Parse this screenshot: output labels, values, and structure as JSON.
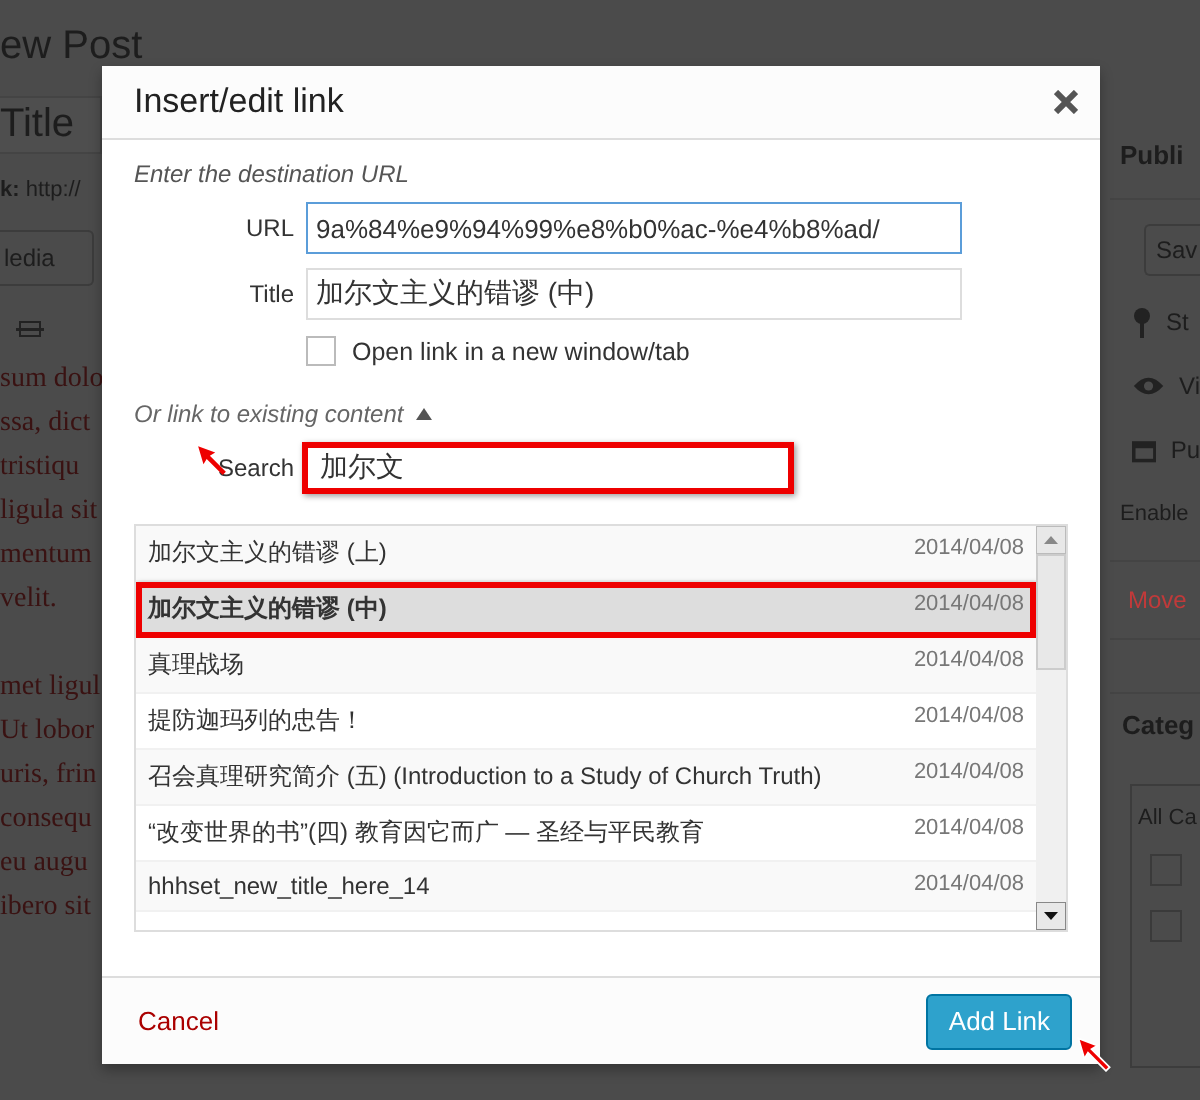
{
  "background": {
    "heading": "ew Post",
    "title_field": "Title",
    "permalink_label": "k:",
    "permalink": "http://",
    "media_button": "ledia",
    "body_paragraphs": [
      [
        "sum dolo",
        "ssa, dict",
        "tristiqu",
        "ligula sit",
        "mentum",
        "velit."
      ],
      [
        "met ligul",
        "Ut lobor",
        "uris, frin",
        "consequ",
        "eu augu",
        "ibero sit"
      ]
    ],
    "sidebar": {
      "publish_heading": "Publi",
      "save_button": "Sav",
      "status": "St",
      "visibility": "Vi",
      "publish": "Pu",
      "enable": "Enable",
      "move": "Move",
      "categories_heading": "Categ",
      "categories_tab": "All Ca",
      "category_checkboxes": [
        {
          "checked": false
        },
        {
          "checked": false
        }
      ]
    }
  },
  "dialog": {
    "title": "Insert/edit link",
    "url_section_label": "Enter the destination URL",
    "url_label": "URL",
    "url_value": "9a%84%e9%94%99%e8%b0%ac-%e4%b8%ad/",
    "title_label": "Title",
    "title_value": "加尔文主义的错谬 (中)",
    "open_new_tab": {
      "label": "Open link in a new window/tab",
      "checked": false
    },
    "existing_toggle": {
      "label": "Or link to existing content",
      "expanded": true
    },
    "search": {
      "label": "Search",
      "value": "加尔文",
      "highlighted": true
    },
    "results": [
      {
        "title": "加尔文主义的错谬 (上)",
        "date": "2014/04/08",
        "selected": false,
        "highlighted": false
      },
      {
        "title": "加尔文主义的错谬 (中)",
        "date": "2014/04/08",
        "selected": true,
        "highlighted": true
      },
      {
        "title": "真理战场",
        "date": "2014/04/08",
        "selected": false,
        "highlighted": false
      },
      {
        "title": "提防迦玛列的忠告！",
        "date": "2014/04/08",
        "selected": false,
        "highlighted": false
      },
      {
        "title": "召会真理研究简介 (五) (Introduction to a Study of Church Truth)",
        "date": "2014/04/08",
        "selected": false,
        "highlighted": false
      },
      {
        "title": "“改变世界的书”(四) 教育因它而广 — 圣经与平民教育",
        "date": "2014/04/08",
        "selected": false,
        "highlighted": false
      },
      {
        "title": "hhhset_new_title_here_14",
        "date": "2014/04/08",
        "selected": false,
        "highlighted": false
      }
    ],
    "cancel": "Cancel",
    "add_link": "Add Link"
  }
}
